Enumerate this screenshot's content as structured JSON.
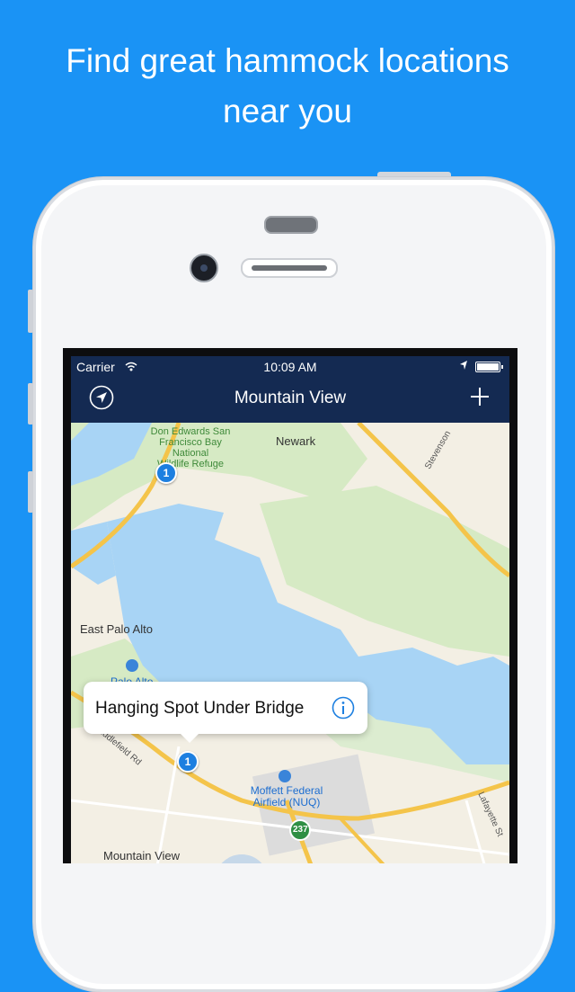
{
  "headline": {
    "line1": "Find great hammock locations",
    "line2": "near you"
  },
  "status_bar": {
    "carrier": "Carrier",
    "time": "10:09 AM"
  },
  "nav": {
    "title": "Mountain View",
    "left_icon": "location-arrow-icon",
    "right_icon": "plus-icon"
  },
  "map": {
    "labels": {
      "refuge": "Don Edwards San Francisco Bay National Wildlife Refuge",
      "refuge_l1": "Don Edwards San",
      "refuge_l2": "Francisco Bay",
      "refuge_l3": "National",
      "refuge_l4": "Wildlife Refuge",
      "newark": "Newark",
      "east_palo_alto": "East Palo Alto",
      "palo_alto": "Palo Alto",
      "middlefield": "iddlefield Rd",
      "moffett_l1": "Moffett Federal",
      "moffett_l2": "Airfield (NUQ)",
      "stevenson": "Stevenson",
      "lafayette": "Lafayette St",
      "mountain_view": "Mountain View",
      "highway": "237"
    },
    "pins": [
      {
        "count": "1"
      },
      {
        "count": "1"
      }
    ],
    "callout": {
      "title": "Hanging Spot Under Bridge",
      "info_icon": "info-icon"
    }
  },
  "colors": {
    "background": "#1a93f5",
    "navbar": "#142a52",
    "water": "#a8d4f5",
    "park": "#d2e8c0",
    "land": "#f3efe4",
    "road": "#f4c44a",
    "pin": "#1d7fe0"
  }
}
